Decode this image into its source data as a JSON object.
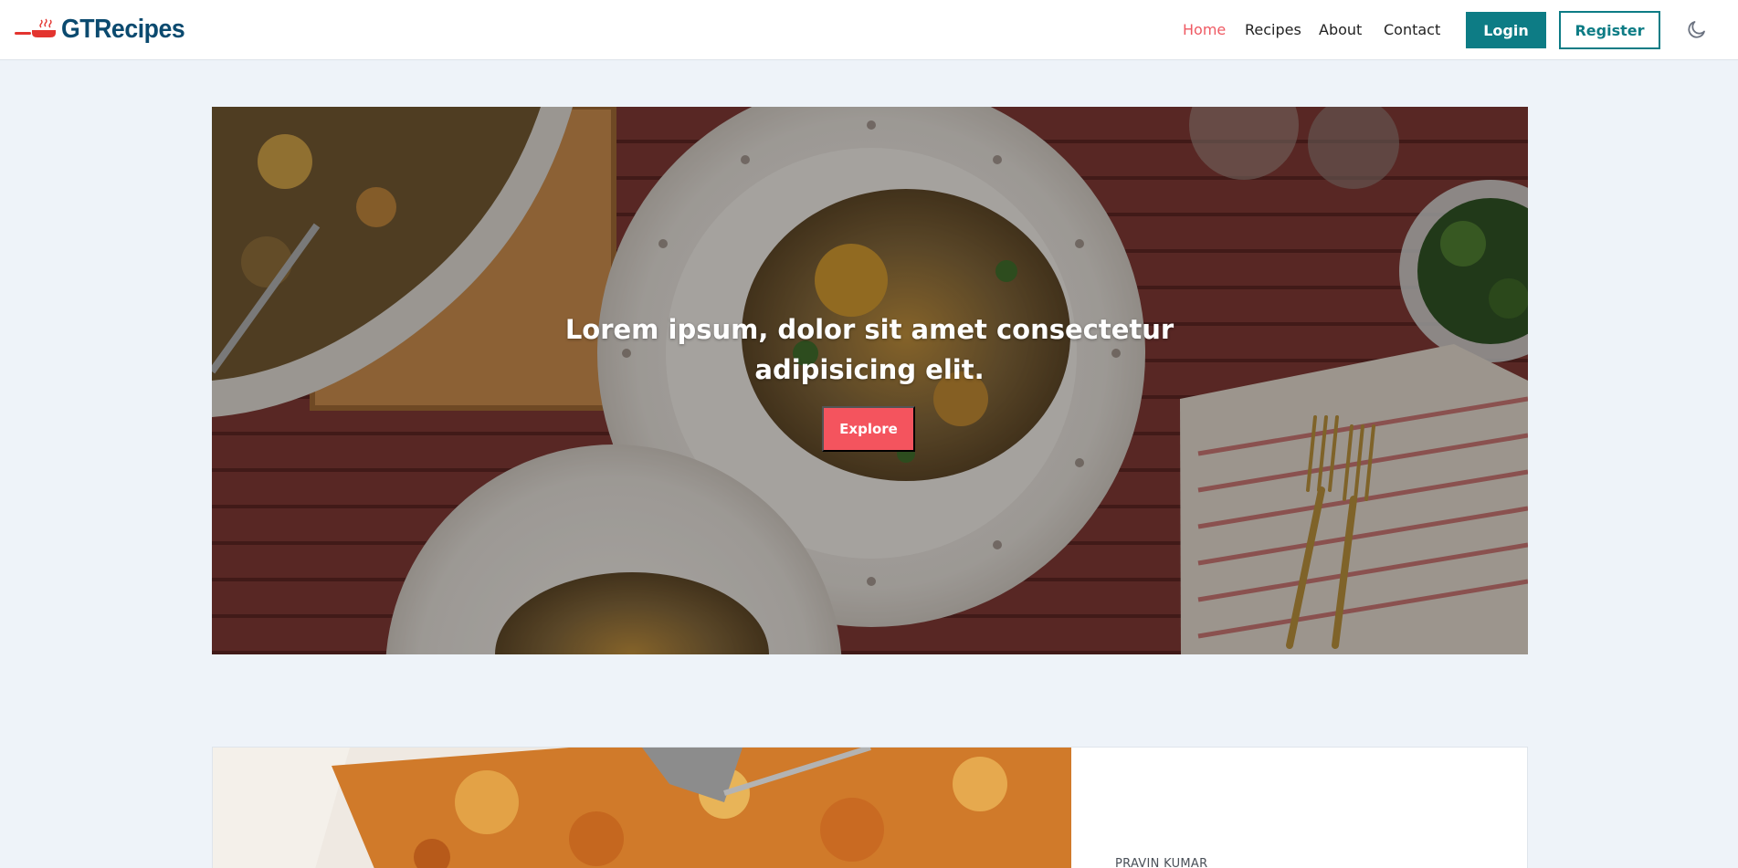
{
  "brand": {
    "name": "GTRecipes",
    "logo_icon": "frying-pan-icon",
    "color": "#0b4a6f",
    "accent": "#e3342f"
  },
  "nav": {
    "links": [
      {
        "label": "Home",
        "active": true
      },
      {
        "label": "Recipes",
        "active": false
      },
      {
        "label": "About",
        "active": false
      },
      {
        "label": "Contact",
        "active": false
      }
    ],
    "login_label": "Login",
    "register_label": "Register",
    "theme_icon": "moon-icon",
    "active_color": "#ef5a63",
    "primary_color": "#0d7c85"
  },
  "hero": {
    "title": "Lorem ipsum, dolor sit amet consectetur adipisicing elit.",
    "button_label": "Explore",
    "button_color": "#f4545e"
  },
  "featured": {
    "author": "PRAVIN KUMAR"
  }
}
